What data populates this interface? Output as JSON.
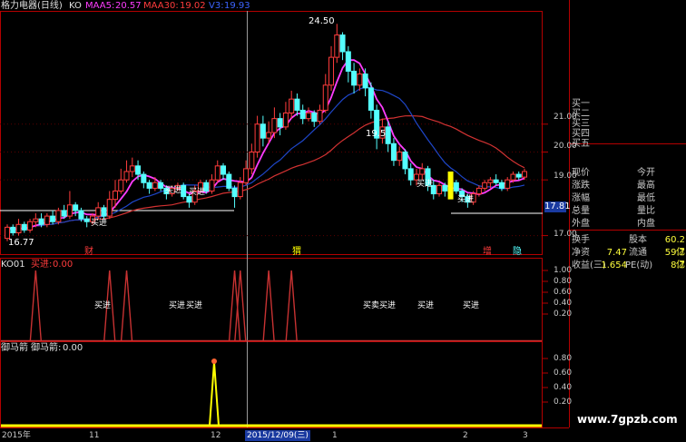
{
  "header": {
    "stock": "格力电器(日线)",
    "ko": "KO",
    "ma5_label": "MAA5:",
    "ma5_value": "20.57",
    "ma30_label": "MAA30:",
    "ma30_value": "19.02",
    "blue_label": "V3:",
    "blue_value": "19.93"
  },
  "subcharts": {
    "ko_title": "KO01",
    "ko_buy_label": "买进:",
    "ko_buy_value": "0.00",
    "yma_title": "御马箭",
    "yma_label": "御马箭:",
    "yma_value": "0.00"
  },
  "annotations": {
    "high": "24.50",
    "low": "16.77",
    "current": "17.81",
    "mid_low": "19.5",
    "buy": "买进",
    "buy_sell": "买卖买进",
    "event_cai": "财",
    "event_wei": "猬",
    "event_zeng": "增",
    "event_xi": "隐"
  },
  "price_axis": [
    "21.00",
    "20.00",
    "19.00",
    "17.00"
  ],
  "ko_axis": [
    "1.00",
    "0.80",
    "0.60",
    "0.40",
    "0.20"
  ],
  "yma_axis": [
    "0.80",
    "0.60",
    "0.40",
    "0.20"
  ],
  "time_axis": {
    "start": "2015年",
    "m11": "11",
    "m12": "12",
    "cursor_date": "2015/12/09(三)",
    "m1": "1",
    "m2": "2",
    "m3": "3"
  },
  "watermark": "www.7gpzb.com",
  "panel": {
    "bids": [
      "买一",
      "买二",
      "买三",
      "买四",
      "买五"
    ],
    "stats": [
      [
        "现价",
        "",
        "今开",
        ""
      ],
      [
        "涨跌",
        "",
        "最高",
        ""
      ],
      [
        "涨幅",
        "",
        "最低",
        ""
      ],
      [
        "总量",
        "",
        "量比",
        ""
      ],
      [
        "外盘",
        "",
        "内盘",
        ""
      ]
    ],
    "stats2": [
      [
        "换手",
        "",
        "股本",
        "60.2亿"
      ],
      [
        "净资",
        "7.47",
        "流通",
        "59.7亿"
      ],
      [
        "收益(三)",
        "1.654",
        "PE(动)",
        "8.7"
      ]
    ]
  },
  "colors": {
    "up": "#ff3c3c",
    "down": "#54ffff",
    "ma5": "#ff3cff",
    "ma30": "#d23232",
    "blue": "#1e46c8",
    "yellow": "#ffff00",
    "frame": "#b40000"
  },
  "chart_data": {
    "type": "candlestick",
    "ylim": [
      16.4,
      25.0
    ],
    "candles": [
      [
        16.9,
        17.3,
        16.8,
        17.4
      ],
      [
        17.3,
        17.1,
        17.0,
        17.4
      ],
      [
        17.1,
        17.4,
        17.0,
        17.6
      ],
      [
        17.4,
        17.2,
        17.1,
        17.5
      ],
      [
        17.2,
        17.5,
        17.1,
        17.6
      ],
      [
        17.5,
        17.6,
        17.3,
        17.8
      ],
      [
        17.6,
        17.4,
        17.3,
        17.8
      ],
      [
        17.4,
        17.7,
        17.3,
        17.8
      ],
      [
        17.7,
        17.5,
        17.4,
        17.9
      ],
      [
        17.5,
        17.9,
        17.4,
        18.0
      ],
      [
        17.9,
        17.7,
        17.6,
        18.1
      ],
      [
        17.7,
        18.1,
        17.6,
        18.6
      ],
      [
        18.1,
        17.9,
        17.7,
        18.2
      ],
      [
        17.9,
        17.6,
        17.5,
        18.0
      ],
      [
        17.6,
        17.5,
        17.3,
        17.7
      ],
      [
        17.5,
        17.7,
        17.4,
        17.8
      ],
      [
        17.7,
        18.0,
        17.6,
        18.2
      ],
      [
        18.0,
        17.7,
        17.6,
        18.1
      ],
      [
        17.7,
        18.3,
        17.6,
        18.6
      ],
      [
        18.3,
        18.6,
        18.0,
        19.0
      ],
      [
        18.6,
        19.0,
        18.5,
        19.4
      ],
      [
        19.0,
        19.3,
        18.9,
        19.7
      ],
      [
        19.3,
        19.5,
        19.1,
        19.8
      ],
      [
        19.5,
        19.2,
        19.0,
        19.7
      ],
      [
        19.2,
        18.9,
        18.7,
        19.3
      ],
      [
        18.9,
        18.7,
        18.5,
        19.0
      ],
      [
        18.7,
        18.9,
        18.6,
        19.1
      ],
      [
        18.9,
        18.7,
        18.6,
        19.0
      ],
      [
        18.7,
        18.5,
        18.3,
        18.8
      ],
      [
        18.5,
        18.7,
        18.4,
        18.8
      ],
      [
        18.7,
        18.8,
        18.6,
        18.9
      ],
      [
        18.8,
        18.4,
        18.3,
        18.9
      ],
      [
        18.4,
        18.2,
        18.0,
        18.5
      ],
      [
        18.2,
        18.6,
        18.1,
        18.8
      ],
      [
        18.6,
        18.9,
        18.5,
        19.0
      ],
      [
        18.9,
        18.6,
        18.5,
        19.0
      ],
      [
        18.6,
        19.0,
        18.5,
        19.2
      ],
      [
        19.0,
        19.5,
        18.9,
        19.7
      ],
      [
        19.5,
        19.2,
        19.0,
        19.6
      ],
      [
        19.2,
        18.7,
        18.6,
        19.3
      ],
      [
        18.7,
        18.4,
        18.0,
        18.8
      ],
      [
        18.4,
        18.9,
        18.3,
        19.1
      ],
      [
        18.9,
        19.4,
        18.8,
        19.7
      ],
      [
        19.4,
        20.0,
        19.2,
        20.3
      ],
      [
        20.0,
        21.0,
        19.8,
        21.3
      ],
      [
        21.0,
        20.5,
        20.2,
        21.3
      ],
      [
        20.5,
        20.7,
        20.3,
        21.1
      ],
      [
        20.7,
        21.2,
        20.5,
        21.6
      ],
      [
        21.2,
        20.9,
        20.6,
        21.4
      ],
      [
        20.9,
        21.4,
        20.8,
        21.8
      ],
      [
        21.4,
        21.9,
        21.2,
        22.2
      ],
      [
        21.9,
        21.5,
        21.3,
        22.1
      ],
      [
        21.5,
        21.2,
        21.0,
        21.7
      ],
      [
        21.2,
        21.4,
        21.1,
        21.6
      ],
      [
        21.4,
        21.1,
        20.9,
        21.5
      ],
      [
        21.1,
        21.5,
        21.0,
        21.7
      ],
      [
        21.5,
        22.4,
        21.4,
        22.8
      ],
      [
        22.4,
        23.4,
        22.2,
        23.8
      ],
      [
        23.4,
        24.2,
        23.2,
        24.6
      ],
      [
        24.2,
        23.6,
        23.3,
        24.3
      ],
      [
        23.6,
        22.9,
        22.5,
        23.8
      ],
      [
        22.9,
        22.4,
        22.1,
        23.2
      ],
      [
        22.4,
        22.8,
        22.2,
        23.0
      ],
      [
        22.8,
        22.3,
        22.0,
        23.0
      ],
      [
        22.3,
        21.5,
        21.2,
        22.5
      ],
      [
        21.5,
        20.5,
        20.1,
        21.7
      ],
      [
        20.5,
        20.9,
        20.3,
        21.2
      ],
      [
        20.9,
        20.3,
        20.0,
        21.1
      ],
      [
        20.3,
        19.7,
        19.5,
        20.5
      ],
      [
        19.7,
        20.0,
        19.5,
        20.2
      ],
      [
        20.0,
        19.4,
        19.2,
        20.1
      ],
      [
        19.4,
        19.0,
        18.8,
        19.6
      ],
      [
        19.0,
        19.2,
        18.8,
        19.4
      ],
      [
        19.2,
        19.4,
        19.0,
        19.6
      ],
      [
        19.4,
        18.8,
        18.6,
        19.5
      ],
      [
        18.8,
        18.5,
        18.3,
        19.0
      ],
      [
        18.5,
        18.8,
        18.4,
        18.9
      ],
      [
        18.8,
        18.6,
        18.4,
        18.9
      ],
      [
        18.6,
        18.9,
        18.5,
        19.0
      ],
      [
        18.9,
        18.6,
        18.5,
        19.0
      ],
      [
        18.6,
        18.4,
        18.2,
        18.7
      ],
      [
        18.4,
        18.2,
        18.0,
        18.5
      ],
      [
        18.2,
        18.5,
        18.1,
        18.6
      ],
      [
        18.5,
        18.7,
        18.4,
        18.8
      ],
      [
        18.7,
        18.9,
        18.6,
        19.0
      ],
      [
        18.9,
        19.0,
        18.7,
        19.1
      ],
      [
        19.0,
        18.9,
        18.8,
        19.2
      ],
      [
        18.9,
        18.7,
        18.6,
        19.0
      ],
      [
        18.7,
        19.0,
        18.6,
        19.1
      ],
      [
        19.0,
        19.2,
        18.9,
        19.3
      ],
      [
        19.2,
        19.1,
        19.0,
        19.3
      ],
      [
        19.1,
        19.3,
        19.0,
        19.4
      ]
    ],
    "ko_signals": [
      5,
      18,
      21,
      40,
      41,
      46,
      50
    ],
    "yma_signals": [
      23
    ]
  }
}
